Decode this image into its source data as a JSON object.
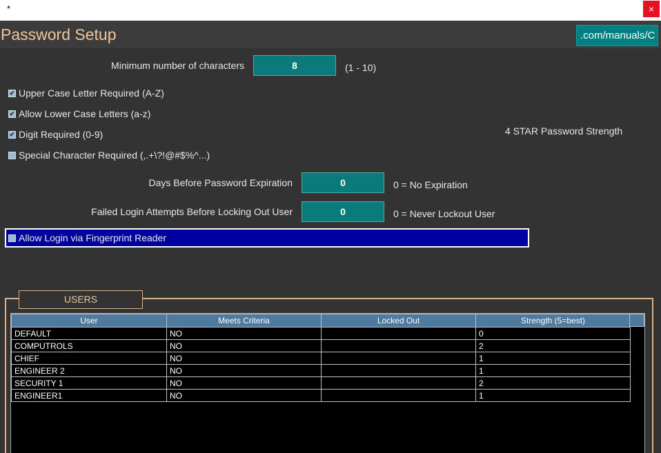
{
  "window": {
    "title": "*",
    "close_label": "×"
  },
  "header": {
    "title": "Password Setup",
    "link_text": ".com/manuals/C"
  },
  "min_chars": {
    "label": "Minimum number of characters",
    "value": "8",
    "range": "(1 - 10)"
  },
  "options": [
    {
      "label": "Upper Case Letter Required (A-Z)",
      "checked": true,
      "mark": "✔"
    },
    {
      "label": "Allow Lower Case Letters (a-z)",
      "checked": true,
      "mark": "✔"
    },
    {
      "label": "Digit Required (0-9)",
      "checked": true,
      "mark": "✔"
    },
    {
      "label": "Special Character Required (,.+\\?!@#$%^...)",
      "checked": false,
      "mark": ""
    }
  ],
  "strength_text": "4 STAR Password Strength",
  "expiration": {
    "label": "Days Before Password Expiration",
    "value": "0",
    "note": "0 = No Expiration"
  },
  "lockout": {
    "label": "Failed Login Attempts Before Locking Out User",
    "value": "0",
    "note": "0 = Never Lockout User"
  },
  "fingerprint": {
    "label": "Allow Login via Fingerprint Reader",
    "checked": false,
    "mark": ""
  },
  "users": {
    "legend": "USERS",
    "columns": [
      "User",
      "Meets Criteria",
      "Locked Out",
      "Strength (5=best)"
    ],
    "rows": [
      [
        "DEFAULT",
        "NO",
        "",
        "0"
      ],
      [
        "COMPUTROLS",
        "NO",
        "",
        "2"
      ],
      [
        "CHIEF",
        "NO",
        "",
        "1"
      ],
      [
        "ENGINEER 2",
        "NO",
        "",
        "1"
      ],
      [
        "SECURITY 1",
        "NO",
        "",
        "2"
      ],
      [
        "ENGINEER1",
        "NO",
        "",
        "1"
      ]
    ]
  }
}
